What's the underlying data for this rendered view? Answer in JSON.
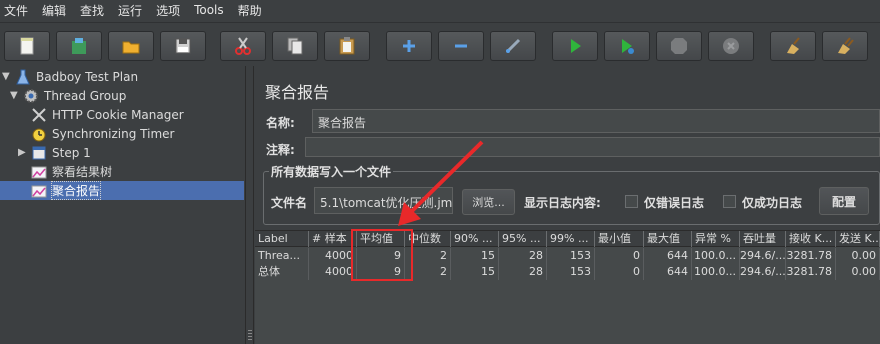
{
  "menu": [
    "文件",
    "编辑",
    "查找",
    "运行",
    "选项",
    "Tools",
    "帮助"
  ],
  "toolbar": [
    {
      "icon": "new-icon"
    },
    {
      "icon": "templates-icon"
    },
    {
      "icon": "open-icon"
    },
    {
      "icon": "save-icon"
    },
    {
      "icon": "cut-icon"
    },
    {
      "icon": "copy-icon"
    },
    {
      "icon": "paste-icon"
    },
    {
      "icon": "expand-icon"
    },
    {
      "icon": "collapse-icon"
    },
    {
      "icon": "toggle-icon"
    },
    {
      "icon": "start-icon"
    },
    {
      "icon": "start-no-pause-icon"
    },
    {
      "icon": "stop-icon"
    },
    {
      "icon": "shutdown-icon"
    },
    {
      "icon": "clear-icon"
    },
    {
      "icon": "clear-all-icon"
    }
  ],
  "tree": [
    {
      "label": "Badboy Test Plan",
      "icon": "test-plan-icon",
      "expanded": true
    },
    {
      "label": "Thread Group",
      "icon": "thread-group-icon",
      "expanded": true
    },
    {
      "label": "HTTP Cookie Manager",
      "icon": "cookie-manager-icon"
    },
    {
      "label": "Synchronizing Timer",
      "icon": "timer-icon"
    },
    {
      "label": "Step 1",
      "icon": "controller-icon",
      "expanded": false
    },
    {
      "label": "察看结果树",
      "icon": "listener-icon"
    },
    {
      "label": "聚合报告",
      "icon": "listener-icon",
      "selected": true
    }
  ],
  "panel": {
    "title": "聚合报告",
    "name_label": "名称:",
    "name_value": "聚合报告",
    "comment_label": "注释:",
    "comment_value": "",
    "group_title": "所有数据写入一个文件",
    "filename_label": "文件名",
    "filename_value": "5.1\\tomcat优化压测.jmx",
    "browse_label": "浏览...",
    "log_label": "显示日志内容:",
    "errors_only_label": "仅错误日志",
    "success_only_label": "仅成功日志",
    "configure_label": "配置"
  },
  "table": {
    "columns": [
      "Label",
      "# 样本",
      "平均值",
      "中位数",
      "90% ...",
      "95% ...",
      "99% ...",
      "最小值",
      "最大值",
      "异常 %",
      "吞吐量",
      "接收 K...",
      "发送 K..."
    ],
    "rows": [
      [
        "Threa...",
        "4000",
        "9",
        "2",
        "15",
        "28",
        "153",
        "0",
        "644",
        "100.0...",
        "294.6/...",
        "3281.78",
        "0.00"
      ],
      [
        "总体",
        "4000",
        "9",
        "2",
        "15",
        "28",
        "153",
        "0",
        "644",
        "100.0...",
        "294.6/...",
        "3281.78",
        "0.00"
      ]
    ]
  },
  "annotation": {
    "color": "#e8292a"
  }
}
